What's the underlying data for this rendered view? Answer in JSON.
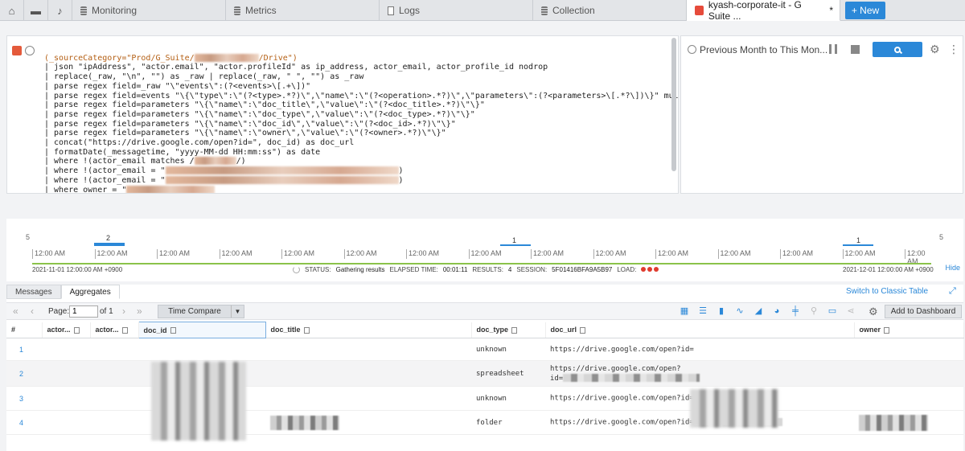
{
  "tabs": {
    "icons": [
      "home-icon",
      "folder-icon",
      "bell-icon"
    ],
    "items": [
      {
        "label": "Monitoring",
        "icon": "database-icon"
      },
      {
        "label": "Metrics",
        "icon": "database-icon"
      },
      {
        "label": "Logs",
        "icon": "document-icon"
      },
      {
        "label": "Collection",
        "icon": "database-icon"
      },
      {
        "label": "kyash-corporate-it - G Suite ...",
        "icon": "calendar-icon",
        "modified": "*"
      }
    ],
    "new_label": "+ New"
  },
  "query": {
    "lines": [
      "(_sourceCategory=\"Prod/G_Suite/",
      "| json \"ipAddress\", \"actor.email\", \"actor.profileId\" as ip_address, actor_email, actor_profile_id nodrop",
      "| replace(_raw, \"\\n\", \"\") as _raw | replace(_raw, \" \", \"\") as _raw",
      "| parse regex field=_raw \"\\\"events\\\":(?<events>\\[.+\\])\"",
      "| parse regex field=events \"\\{\\\"type\\\":\\\"(?<type>.*?)\\\",\\\"name\\\":\\\"(?<operation>.*?)\\\",\\\"parameters\\\":(?<parameters>\\[.*?\\])\\}\" multi",
      "| parse regex field=parameters \"\\{\\\"name\\\":\\\"doc_title\\\",\\\"value\\\":\\\"(?<doc_title>.*?)\\\"\\}\"",
      "| parse regex field=parameters \"\\{\\\"name\\\":\\\"doc_type\\\",\\\"value\\\":\\\"(?<doc_type>.*?)\\\"\\}\"",
      "| parse regex field=parameters \"\\{\\\"name\\\":\\\"doc_id\\\",\\\"value\\\":\\\"(?<doc_id>.*?)\\\"\\}\"",
      "| parse regex field=parameters \"\\{\\\"name\\\":\\\"owner\\\",\\\"value\\\":\\\"(?<owner>.*?)\\\"\\}\"",
      "| concat(\"https://drive.google.com/open?id=\", doc_id) as doc_url",
      "| formatDate(_messagetime, \"yyyy-MM-dd HH:mm:ss\") as date",
      "| where !(actor_email matches /",
      "| where !(actor_email = \"",
      "| where !(actor_email = \"",
      "| where owner = \""
    ],
    "line0_tail": "/Drive\")",
    "line11_tail": "/)",
    "line12_tail": ")",
    "line13_tail": ")"
  },
  "time_panel": {
    "range_label": "Previous Month to This Mon...",
    "icons": [
      "clock-icon",
      "pause-icon",
      "stop-icon",
      "search-icon",
      "gear-icon",
      "more-vertical-icon"
    ]
  },
  "histogram": {
    "y_max_left": "5",
    "y_max_right": "5",
    "tick_label": "12:00 AM",
    "bars": [
      {
        "count": 2,
        "label": "2"
      },
      {
        "count": 1,
        "label": "1"
      },
      {
        "count": 1,
        "label": "1"
      }
    ],
    "start": "2021-11-01 12:00:00 AM +0900",
    "end": "2021-12-01 12:00:00 AM +0900",
    "status_label": "STATUS:",
    "status_value": "Gathering results",
    "elapsed_label": "ELAPSED TIME:",
    "elapsed_value": "00:01:11",
    "results_label": "RESULTS:",
    "results_value": "4",
    "session_label": "SESSION:",
    "session_value": "5F01416BFA9A5B97",
    "load_label": "LOAD:",
    "hide_label": "Hide"
  },
  "results": {
    "tabs": [
      "Messages",
      "Aggregates"
    ],
    "switch_label": "Switch to Classic Table",
    "page_label": "Page:",
    "page_value": "1",
    "of_label": "of 1",
    "time_compare_label": "Time Compare",
    "add_dashboard_label": "Add to Dashboard",
    "chart_icons": [
      "table-icon",
      "bar-horizontal-icon",
      "column-chart-icon",
      "line-chart-icon",
      "area-chart-icon",
      "pie-chart-icon",
      "box-plot-icon",
      "map-pin-icon",
      "single-value-icon",
      "funnel-icon"
    ],
    "columns": [
      "#",
      "actor...",
      "actor...",
      "doc_id",
      "doc_title",
      "doc_type",
      "doc_url",
      "owner"
    ],
    "rows": [
      {
        "num": "1",
        "doc_type": "unknown",
        "doc_url": "https://drive.google.com/open?id="
      },
      {
        "num": "2",
        "doc_type": "spreadsheet",
        "doc_url": "https://drive.google.com/open?",
        "doc_url2": "id="
      },
      {
        "num": "3",
        "doc_type": "unknown",
        "doc_url": "https://drive.google.com/open?id="
      },
      {
        "num": "4",
        "doc_type": "folder",
        "doc_url": "https://drive.google.com/open?id="
      }
    ]
  }
}
